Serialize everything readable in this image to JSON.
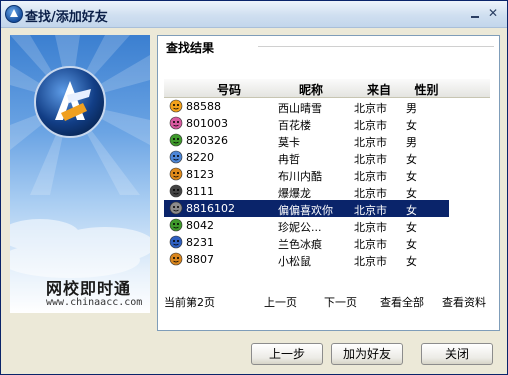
{
  "window": {
    "title": "查找/添加好友"
  },
  "left_panel": {
    "brand": "网校即时通",
    "domain": "www.chinaacc.com"
  },
  "results": {
    "group_title": "查找结果",
    "columns": [
      "号码",
      "昵称",
      "来自",
      "性别"
    ],
    "rows": [
      {
        "id": "88588",
        "nick": "西山晴雪",
        "from": "北京市",
        "sex": "男",
        "icon": "orange-face-avatar-icon"
      },
      {
        "id": "801003",
        "nick": "百花楼",
        "from": "北京市",
        "sex": "女",
        "icon": "pink-hair-avatar-icon"
      },
      {
        "id": "820326",
        "nick": "莫卡",
        "from": "北京市",
        "sex": "男",
        "icon": "green-person-avatar-icon"
      },
      {
        "id": "8220",
        "nick": "冉哲",
        "from": "北京市",
        "sex": "女",
        "icon": "blue-face-avatar-icon"
      },
      {
        "id": "8123",
        "nick": "布川内酷",
        "from": "北京市",
        "sex": "女",
        "icon": "tiger-avatar-icon"
      },
      {
        "id": "8111",
        "nick": "爆爆龙",
        "from": "北京市",
        "sex": "女",
        "icon": "dark-hair-avatar-icon"
      },
      {
        "id": "8816102",
        "nick": "偏偏喜欢你",
        "from": "北京市",
        "sex": "女",
        "icon": "gray-face-avatar-icon",
        "selected": true
      },
      {
        "id": "8042",
        "nick": "珍妮公...",
        "from": "北京市",
        "sex": "女",
        "icon": "green-person-avatar-icon"
      },
      {
        "id": "8231",
        "nick": "兰色冰痕",
        "from": "北京市",
        "sex": "女",
        "icon": "blue-hair-avatar-icon"
      },
      {
        "id": "8807",
        "nick": "小松鼠",
        "from": "北京市",
        "sex": "女",
        "icon": "squirrel-avatar-icon"
      }
    ]
  },
  "pager": {
    "current_page": "当前第2页",
    "prev": "上一页",
    "next": "下一页",
    "view_all": "查看全部",
    "view_profile": "查看资料"
  },
  "buttons": {
    "back": "上一步",
    "add_friend": "加为好友",
    "close": "关闭"
  },
  "colors": {
    "selection": "#0a246a",
    "title_text": "#0b1f48"
  }
}
